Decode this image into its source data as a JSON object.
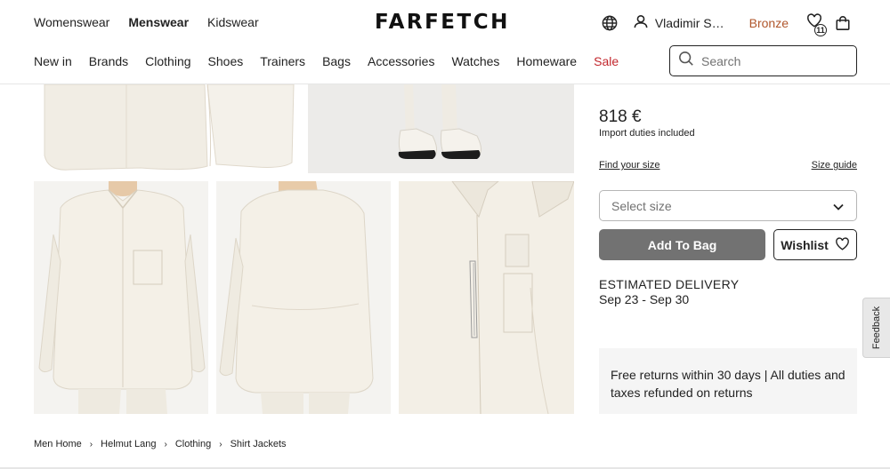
{
  "header": {
    "gender_nav": [
      "Womenswear",
      "Menswear",
      "Kidswear"
    ],
    "logo": "FARFETCH",
    "user_name": "Vladimir S…",
    "tier": "Bronze",
    "wishlist_count": "11",
    "icons": [
      "globe-icon",
      "user-icon",
      "wishlist-icon",
      "bag-icon"
    ]
  },
  "nav": {
    "categories": [
      "New in",
      "Brands",
      "Clothing",
      "Shoes",
      "Trainers",
      "Bags",
      "Accessories",
      "Watches",
      "Homeware",
      "Sale"
    ]
  },
  "search": {
    "placeholder": "Search",
    "value": ""
  },
  "product": {
    "price": "818 €",
    "duties_note": "Import duties included",
    "find_size": "Find your size",
    "size_guide": "Size guide",
    "select_size": "Select size",
    "add_to_bag": "Add To Bag",
    "wishlist": "Wishlist",
    "delivery_title": "ESTIMATED DELIVERY",
    "delivery_dates": "Sep 23 - Sep 30",
    "returns_line1": "Free returns within 30 days | All duties and",
    "returns_line2": "taxes refunded on returns"
  },
  "feedback": "Feedback",
  "breadcrumb": [
    "Men Home",
    "Helmut Lang",
    "Clothing",
    "Shirt Jackets"
  ],
  "colors": {
    "accent_sale": "#c2272d",
    "tier": "#b0562b",
    "primary_button": "#727272",
    "garment": "#f1ede4"
  }
}
